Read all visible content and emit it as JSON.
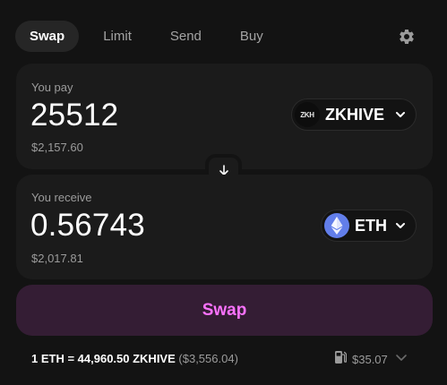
{
  "tabs": [
    {
      "label": "Swap",
      "active": true
    },
    {
      "label": "Limit",
      "active": false
    },
    {
      "label": "Send",
      "active": false
    },
    {
      "label": "Buy",
      "active": false
    }
  ],
  "settings_icon": "gear-icon",
  "pay": {
    "label": "You pay",
    "amount": "25512",
    "usd": "$2,157.60",
    "token": {
      "symbol": "ZKHIVE",
      "logo_text": "ZKH"
    }
  },
  "receive": {
    "label": "You receive",
    "amount": "0.56743",
    "usd": "$2,017.81",
    "token": {
      "symbol": "ETH",
      "logo_icon": "ethereum-icon"
    }
  },
  "swap_button": {
    "label": "Swap"
  },
  "rate": {
    "text": "1 ETH = 44,960.50 ZKHIVE",
    "usd": "($3,556.04)"
  },
  "gas": {
    "icon": "gas-pump-icon",
    "value": "$35.07"
  },
  "colors": {
    "background": "#131313",
    "panel": "#1b1b1b",
    "accent": "#fc72ff",
    "accent_bg": "#341d34",
    "eth": "#627eea"
  }
}
